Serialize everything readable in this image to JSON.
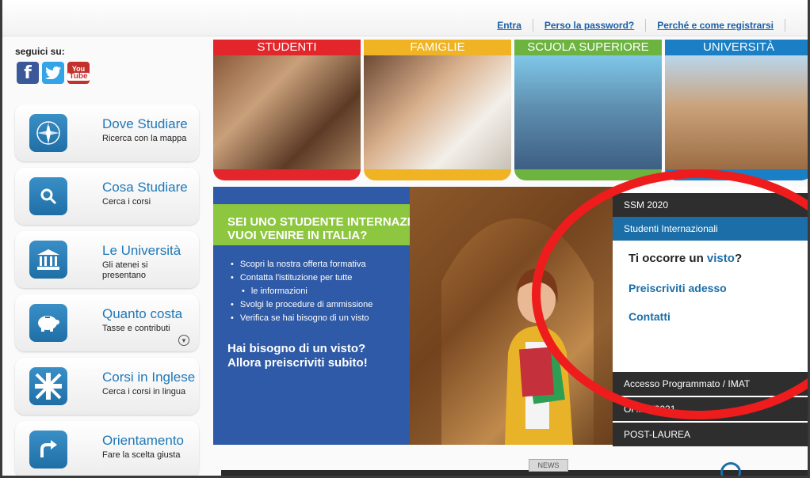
{
  "colors": {
    "link_blue": "#1a5fa8",
    "menu_title_blue": "#1f78b8",
    "tile_studenti": "#e3262b",
    "tile_famiglie": "#f0b323",
    "tile_scuola": "#6cb43f",
    "tile_universita": "#1a7fc4",
    "banner_blue": "#2e5aa7",
    "banner_green": "#8dc63f",
    "tab_dark": "#2e2e2e",
    "tab_active": "#1b6ea8",
    "annotation_red": "#ee1c1c"
  },
  "topbar": {
    "login": "Entra",
    "lost_password": "Perso la password?",
    "register": "Perché e come registrarsi"
  },
  "sidebar": {
    "follow_label": "seguici su:",
    "social": [
      {
        "name": "facebook-icon",
        "glyph": "f"
      },
      {
        "name": "twitter-icon",
        "glyph": "🐦"
      },
      {
        "name": "youtube-icon",
        "glyph_top": "You",
        "glyph_bottom": "Tube"
      }
    ],
    "items": [
      {
        "title": "Dove Studiare",
        "subtitle": "Ricerca con la mappa",
        "icon": "compass-icon"
      },
      {
        "title": "Cosa Studiare",
        "subtitle": "Cerca i corsi",
        "icon": "search-icon"
      },
      {
        "title": "Le Università",
        "subtitle": "Gli atenei si presentano",
        "icon": "university-building-icon"
      },
      {
        "title": "Quanto costa",
        "subtitle": "Tasse e contributi",
        "icon": "piggy-bank-icon"
      },
      {
        "title": "Corsi in Inglese",
        "subtitle": "Cerca i corsi in lingua",
        "icon": "union-jack-icon"
      },
      {
        "title": "Orientamento",
        "subtitle": "Fare la scelta giusta",
        "icon": "arrow-turn-icon"
      }
    ]
  },
  "tiles": [
    {
      "label": "STUDENTI"
    },
    {
      "label": "FAMIGLIE"
    },
    {
      "label": "SCUOLA SUPERIORE"
    },
    {
      "label": "UNIVERSITÀ"
    }
  ],
  "banner": {
    "title_line1": "SEI UNO STUDENTE INTERNAZIONALE?",
    "title_line2": "VUOI VENIRE IN ITALIA?",
    "bullets": [
      "Scopri la nostra offerta formativa",
      "Contatta l'istituzione per tutte",
      "le informazioni",
      "Svolgi le procedure di ammissione",
      "Verifica se hai bisogno di un visto"
    ],
    "cta_line1": "Hai bisogno di un visto?",
    "cta_line2": "Allora preiscriviti subito!"
  },
  "panel": {
    "tab_ssm": "SSM 2020",
    "tab_intl": "Studenti Internazionali",
    "visto_prefix": "Ti occorre un",
    "visto_word": "visto",
    "visto_suffix": "?",
    "preiscriviti": "Preiscriviti adesso",
    "contatti": "Contatti",
    "tab_imat": "Accesso Programmato / IMAT",
    "tab_offerta": "OF... 0/2021",
    "tab_post": "POST-LAUREA"
  },
  "footer": {
    "news_label": "NEWS"
  }
}
